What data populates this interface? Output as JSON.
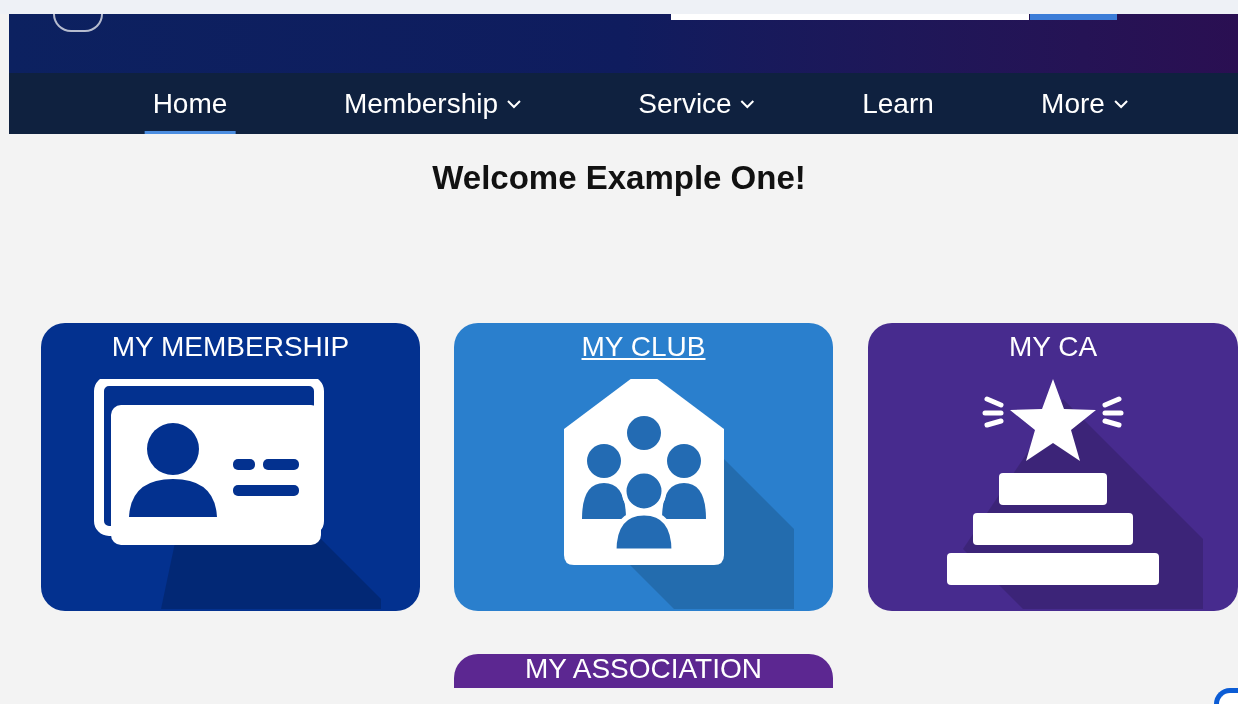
{
  "nav": [
    {
      "label": "Home",
      "has_menu": false,
      "selected": true
    },
    {
      "label": "Membership",
      "has_menu": true,
      "selected": false
    },
    {
      "label": "Service",
      "has_menu": true,
      "selected": false
    },
    {
      "label": "Learn",
      "has_menu": false,
      "selected": false
    },
    {
      "label": "More",
      "has_menu": true,
      "selected": false
    }
  ],
  "welcome": "Welcome Example One!",
  "tiles": [
    {
      "title": "MY MEMBERSHIP",
      "kind": "membership",
      "color": "#03318f",
      "hovered": false
    },
    {
      "title": "MY CLUB",
      "kind": "club",
      "color": "#2a7fcd",
      "hovered": true
    },
    {
      "title": "MY CA",
      "kind": "ca",
      "color": "#472b8e",
      "hovered": false
    },
    {
      "title": "MY ASSOCIATION",
      "kind": "association",
      "color": "#5c2791",
      "hovered": false
    }
  ]
}
